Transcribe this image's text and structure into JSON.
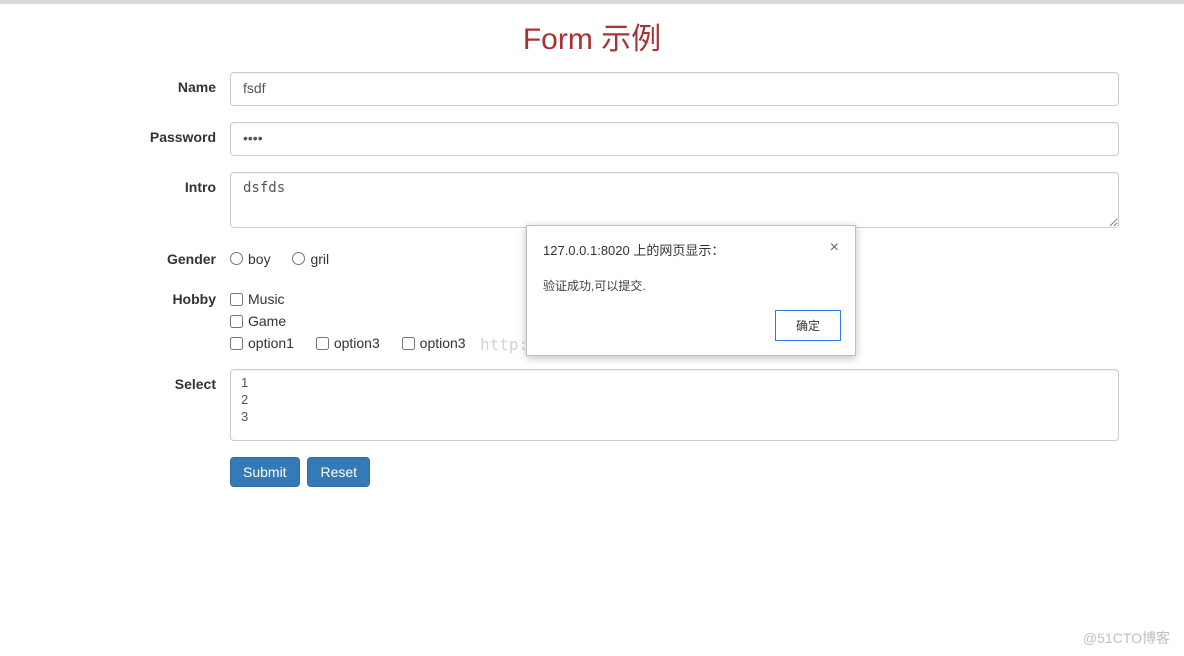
{
  "title": "Form 示例",
  "form": {
    "name_label": "Name",
    "name_value": "fsdf",
    "password_label": "Password",
    "password_value": "••••",
    "intro_label": "Intro",
    "intro_value": "dsfds",
    "gender": {
      "label": "Gender",
      "options": [
        {
          "label": "boy"
        },
        {
          "label": "gril"
        }
      ]
    },
    "hobby": {
      "label": "Hobby",
      "stacked": [
        {
          "label": "Music"
        },
        {
          "label": "Game"
        }
      ],
      "inline": [
        {
          "label": "option1"
        },
        {
          "label": "option3"
        },
        {
          "label": "option3"
        }
      ]
    },
    "select": {
      "label": "Select",
      "options": [
        "1",
        "2",
        "3"
      ]
    },
    "buttons": {
      "submit": "Submit",
      "reset": "Reset"
    }
  },
  "dialog": {
    "title": "127.0.0.1:8020 上的网页显示：",
    "message": "验证成功,可以提交.",
    "confirm": "确定"
  },
  "watermark_url": "http://blog.csdn.net/zoutongyuan",
  "footer_watermark": "@51CTO博客"
}
